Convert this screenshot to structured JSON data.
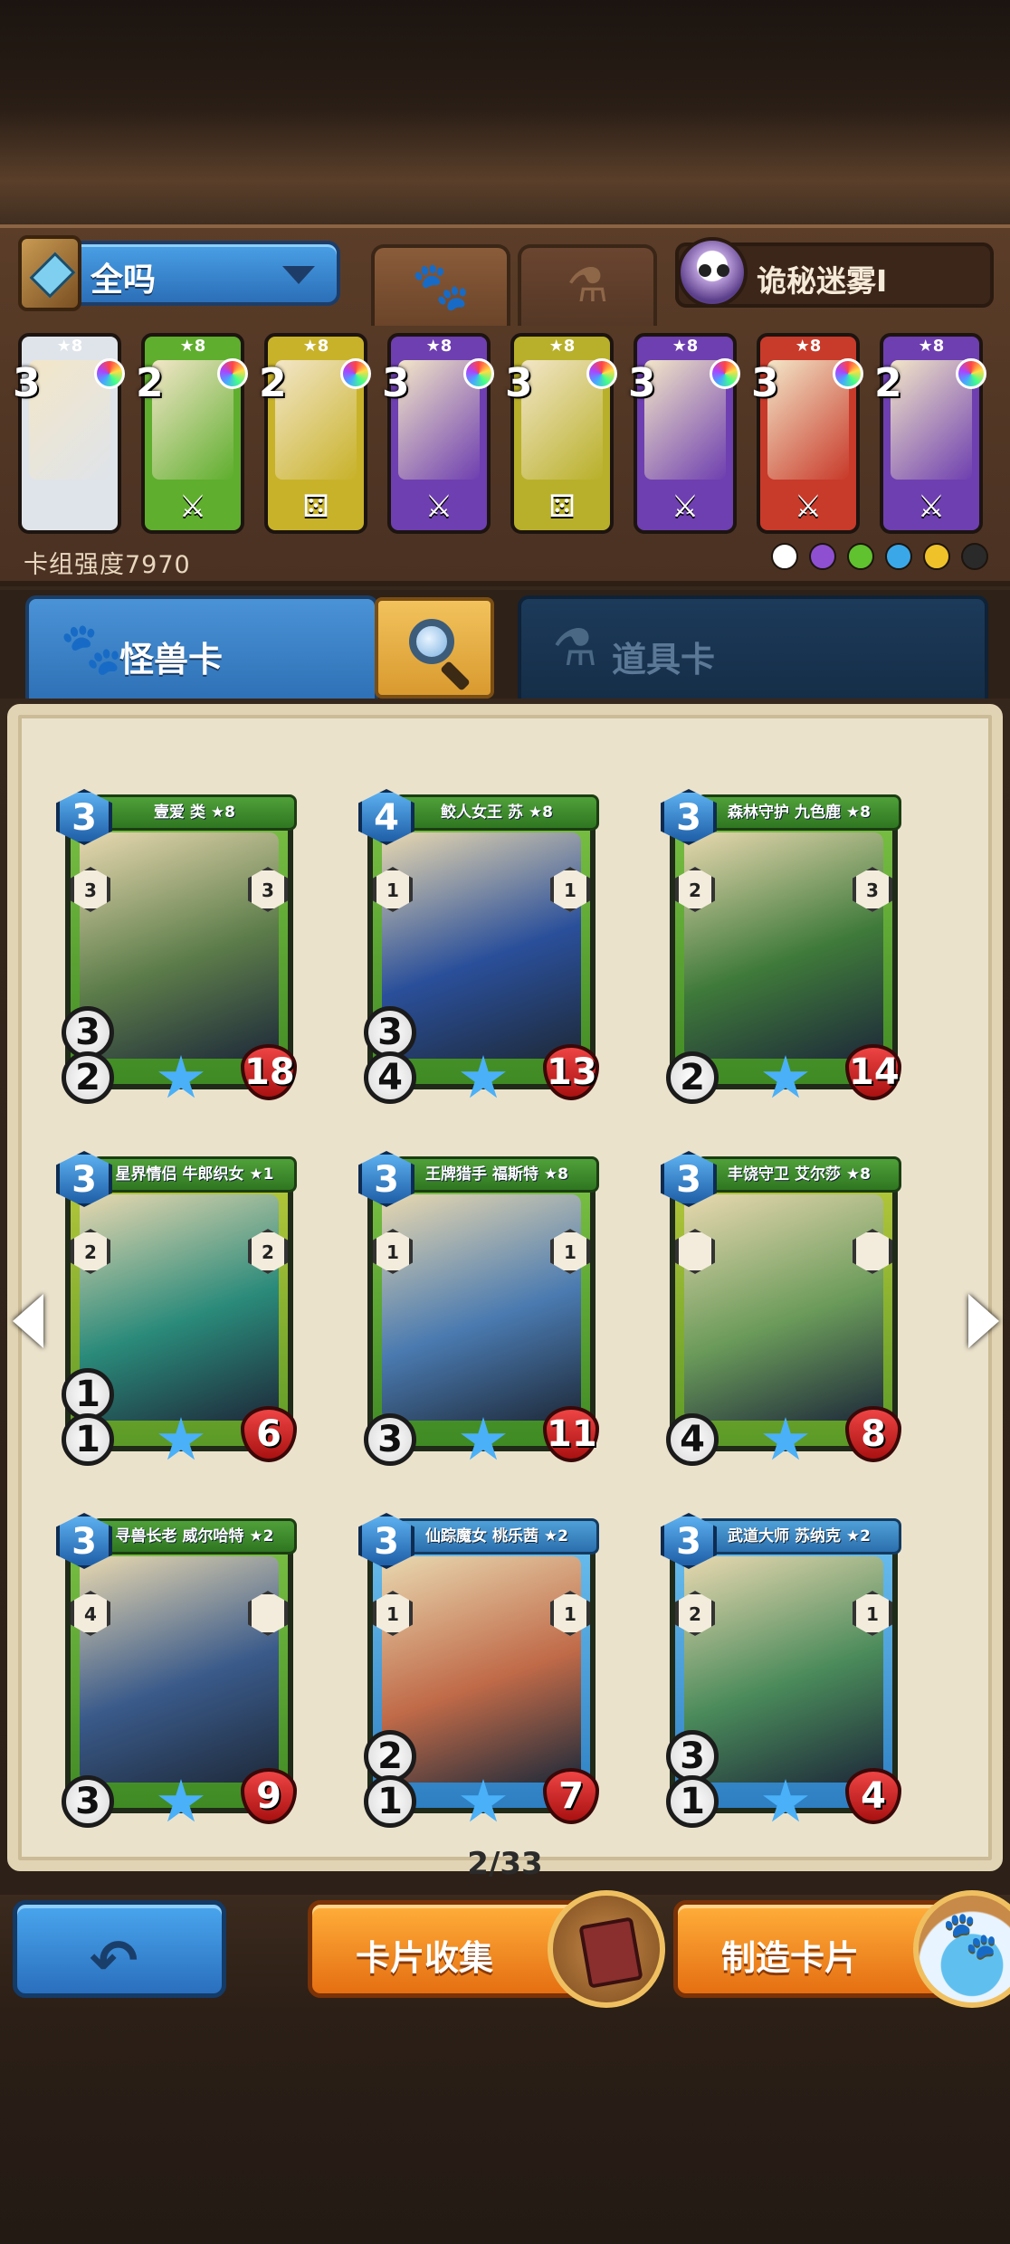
{
  "deck": {
    "name": "全吗",
    "power_label": "卡组强度7970",
    "hero_name": "诡秘迷雾I",
    "cards": [
      {
        "level": "★8",
        "cost": "3",
        "color": "#dfe4ea",
        "bottom_icon": ""
      },
      {
        "level": "★8",
        "cost": "2",
        "color": "#5fae2e",
        "bottom_icon": "⚔"
      },
      {
        "level": "★8",
        "cost": "2",
        "color": "#c8b22a",
        "bottom_icon": "⚄"
      },
      {
        "level": "★8",
        "cost": "3",
        "color": "#6e3fb0",
        "bottom_icon": "⚔"
      },
      {
        "level": "★8",
        "cost": "3",
        "color": "#b8b02a",
        "bottom_icon": "⚄"
      },
      {
        "level": "★8",
        "cost": "3",
        "color": "#6e3fb0",
        "bottom_icon": "⚔"
      },
      {
        "level": "★8",
        "cost": "3",
        "color": "#c83a2a",
        "bottom_icon": "⚔"
      },
      {
        "level": "★8",
        "cost": "2",
        "color": "#6e3fb0",
        "bottom_icon": "⚔"
      }
    ],
    "legend_colors": [
      "#ffffff",
      "#8e4fd0",
      "#5fc22e",
      "#3aa8e8",
      "#f0c22a",
      "#2a2a2a"
    ]
  },
  "tabs": {
    "monster": "怪兽卡",
    "item": "道具卡"
  },
  "cards": [
    {
      "name": "壹爱 类 ★8",
      "cost": "3",
      "attack": "3",
      "defense": "2",
      "hp": "18",
      "left_val": "3",
      "right_val": "3",
      "style": "green",
      "art": "#5d7d4a"
    },
    {
      "name": "鲛人女王 苏 ★8",
      "cost": "4",
      "attack": "3",
      "defense": "4",
      "hp": "13",
      "left_val": "1",
      "right_val": "1",
      "style": "green",
      "art": "#2a4f9a"
    },
    {
      "name": "森林守护 九色鹿 ★8",
      "cost": "3",
      "attack": "",
      "defense": "2",
      "hp": "14",
      "left_val": "2",
      "right_val": "3",
      "style": "green",
      "art": "#3f7a3a"
    },
    {
      "name": "星界情侣 牛郎织女 ★1",
      "cost": "3",
      "attack": "1",
      "defense": "1",
      "hp": "6",
      "left_val": "2",
      "right_val": "2",
      "style": "goldgreen",
      "art": "#2a8a7a"
    },
    {
      "name": "王牌猎手 福斯特 ★8",
      "cost": "3",
      "attack": "",
      "defense": "3",
      "hp": "11",
      "left_val": "1",
      "right_val": "1",
      "style": "green",
      "art": "#4a7ab0"
    },
    {
      "name": "丰饶守卫 艾尔莎 ★8",
      "cost": "3",
      "attack": "",
      "defense": "4",
      "hp": "8",
      "left_val": "",
      "right_val": "",
      "style": "goldgreen",
      "art": "#6a9a5a"
    },
    {
      "name": "寻兽长老 威尔哈特 ★2",
      "cost": "3",
      "attack": "",
      "defense": "3",
      "hp": "9",
      "left_val": "4",
      "right_val": "",
      "style": "green",
      "art": "#3a5a8a"
    },
    {
      "name": "仙踪魔女 桃乐茜 ★2",
      "cost": "3",
      "attack": "2",
      "defense": "1",
      "hp": "7",
      "left_val": "1",
      "right_val": "1",
      "style": "blue",
      "art": "#c06a48"
    },
    {
      "name": "武道大师 苏纳克 ★2",
      "cost": "3",
      "attack": "3",
      "defense": "1",
      "hp": "4",
      "left_val": "2",
      "right_val": "1",
      "style": "blue",
      "art": "#4a8a5a"
    }
  ],
  "pager": "2/33",
  "buttons": {
    "collection": "卡片收集",
    "craft": "制造卡片"
  }
}
